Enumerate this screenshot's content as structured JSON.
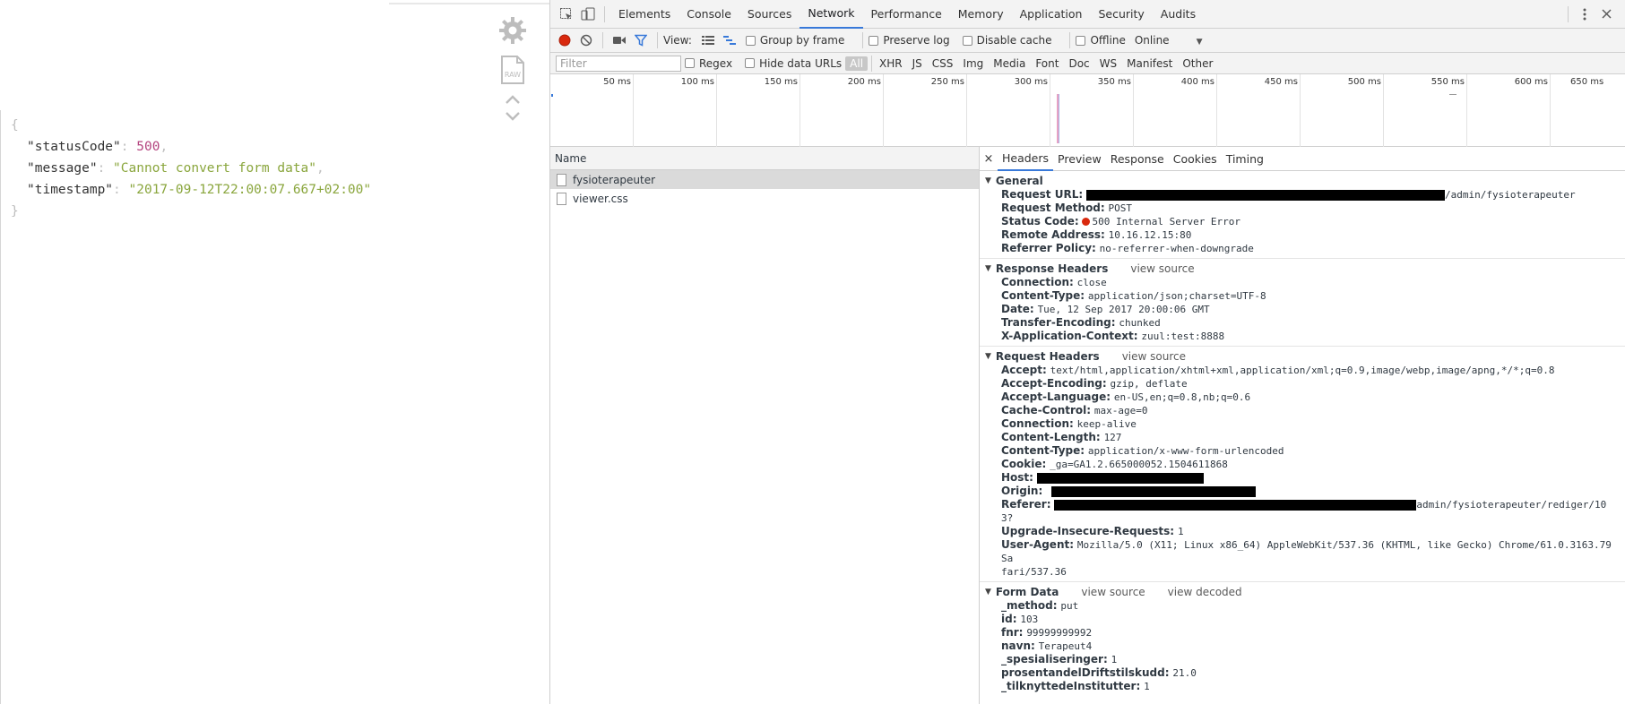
{
  "viewer": {
    "json_lines": [
      {
        "key": "\"statusCode\"",
        "value": "500",
        "type": "num",
        "trail": ","
      },
      {
        "key": "\"message\"",
        "value": "\"Cannot convert form data\"",
        "type": "str",
        "trail": ","
      },
      {
        "key": "\"timestamp\"",
        "value": "\"2017-09-12T22:00:07.667+02:00\"",
        "type": "str",
        "trail": ""
      }
    ],
    "open_brace": "{",
    "close_brace": "}",
    "raw_label": "RAW"
  },
  "devtools": {
    "tabs": [
      "Elements",
      "Console",
      "Sources",
      "Network",
      "Performance",
      "Memory",
      "Application",
      "Security",
      "Audits"
    ],
    "active_tab": "Network",
    "toolbar": {
      "view_label": "View:",
      "group_by_frame": "Group by frame",
      "preserve_log": "Preserve log",
      "disable_cache": "Disable cache",
      "offline": "Offline",
      "throttle": "Online"
    },
    "filterbar": {
      "filter_placeholder": "Filter",
      "regex": "Regex",
      "hide_data_urls": "Hide data URLs",
      "types": [
        "All",
        "XHR",
        "JS",
        "CSS",
        "Img",
        "Media",
        "Font",
        "Doc",
        "WS",
        "Manifest",
        "Other"
      ],
      "active_type": "All"
    },
    "timeline_ticks": [
      "50 ms",
      "100 ms",
      "150 ms",
      "200 ms",
      "250 ms",
      "300 ms",
      "350 ms",
      "400 ms",
      "450 ms",
      "500 ms",
      "550 ms",
      "600 ms",
      "650 ms"
    ],
    "request_list": {
      "header": "Name",
      "rows": [
        "fysioterapeuter",
        "viewer.css"
      ]
    },
    "details": {
      "close": "×",
      "tabs": [
        "Headers",
        "Preview",
        "Response",
        "Cookies",
        "Timing"
      ],
      "active_tab": "Headers",
      "general": {
        "title": "General",
        "request_url_label": "Request URL:",
        "request_url_tail": "/admin/fysioterapeuter",
        "request_method_label": "Request Method:",
        "request_method": "POST",
        "status_code_label": "Status Code:",
        "status_code": "500 Internal Server Error",
        "remote_address_label": "Remote Address:",
        "remote_address": "10.16.12.15:80",
        "referrer_policy_label": "Referrer Policy:",
        "referrer_policy": "no-referrer-when-downgrade"
      },
      "response_headers": {
        "title": "Response Headers",
        "view_source": "view source",
        "items": [
          {
            "k": "Connection:",
            "v": "close"
          },
          {
            "k": "Content-Type:",
            "v": "application/json;charset=UTF-8"
          },
          {
            "k": "Date:",
            "v": "Tue, 12 Sep 2017 20:00:06 GMT"
          },
          {
            "k": "Transfer-Encoding:",
            "v": "chunked"
          },
          {
            "k": "X-Application-Context:",
            "v": "zuul:test:8888"
          }
        ]
      },
      "request_headers": {
        "title": "Request Headers",
        "view_source": "view source",
        "items_before": [
          {
            "k": "Accept:",
            "v": "text/html,application/xhtml+xml,application/xml;q=0.9,image/webp,image/apng,*/*;q=0.8"
          },
          {
            "k": "Accept-Encoding:",
            "v": "gzip, deflate"
          },
          {
            "k": "Accept-Language:",
            "v": "en-US,en;q=0.8,nb;q=0.6"
          },
          {
            "k": "Cache-Control:",
            "v": "max-age=0"
          },
          {
            "k": "Connection:",
            "v": "keep-alive"
          },
          {
            "k": "Content-Length:",
            "v": "127"
          },
          {
            "k": "Content-Type:",
            "v": "application/x-www-form-urlencoded"
          },
          {
            "k": "Cookie:",
            "v": "_ga=GA1.2.665000052.1504611868"
          }
        ],
        "host_label": "Host:",
        "origin_label": "Origin:",
        "referer_label": "Referer:",
        "referer_tail": "admin/fysioterapeuter/rediger/10",
        "referer_wrap": "3?",
        "upgrade_label": "Upgrade-Insecure-Requests:",
        "upgrade_value": "1",
        "user_agent_label": "User-Agent:",
        "user_agent_value": "Mozilla/5.0 (X11; Linux x86_64) AppleWebKit/537.36 (KHTML, like Gecko) Chrome/61.0.3163.79 Sa",
        "user_agent_wrap": "fari/537.36"
      },
      "form_data": {
        "title": "Form Data",
        "view_source": "view source",
        "view_decoded": "view decoded",
        "items": [
          {
            "k": "_method:",
            "v": "put"
          },
          {
            "k": "id:",
            "v": "103"
          },
          {
            "k": "fnr:",
            "v": "99999999992"
          },
          {
            "k": "navn:",
            "v": "Terapeut4"
          },
          {
            "k": "_spesialiseringer:",
            "v": "1"
          },
          {
            "k": "prosentandelDriftstilskudd:",
            "v": "21.0"
          },
          {
            "k": "_tilknyttedeInstitutter:",
            "v": "1"
          }
        ]
      }
    }
  },
  "colors": {
    "accent": "#3879d9",
    "record": "#d9290e"
  }
}
